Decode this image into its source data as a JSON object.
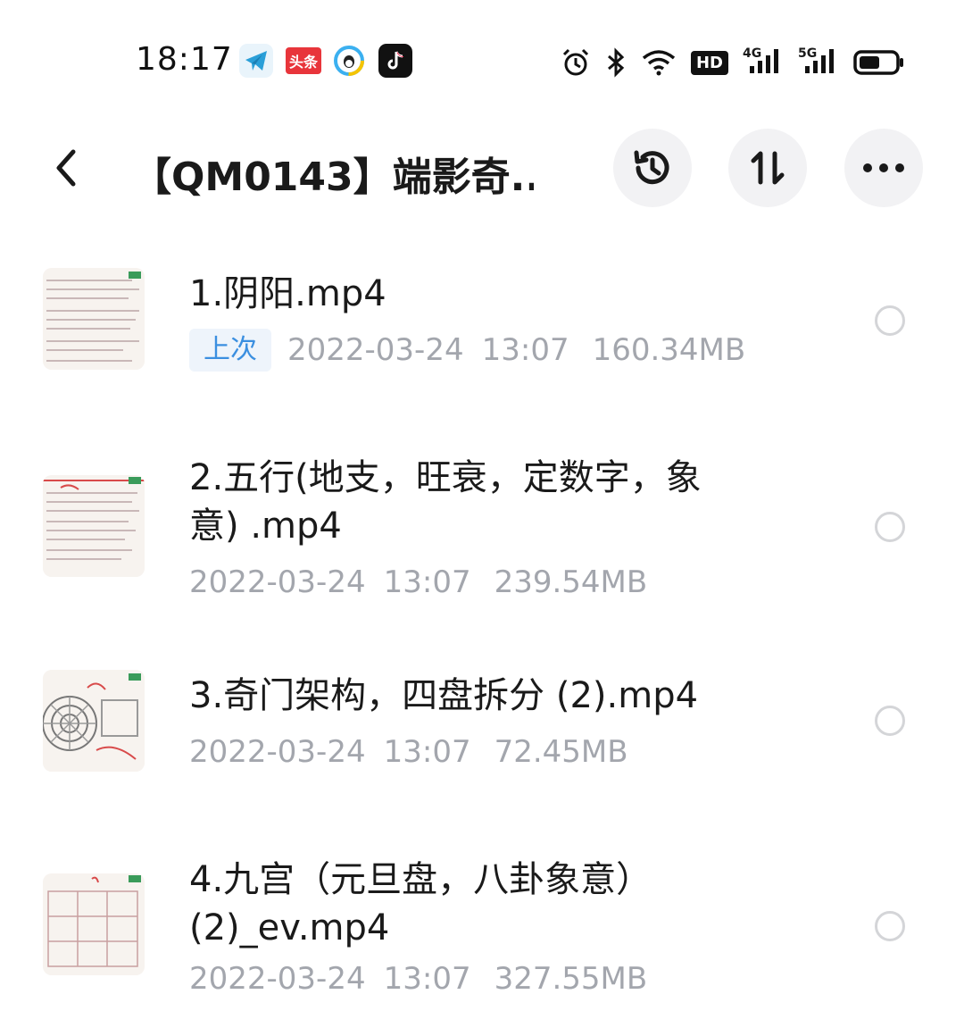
{
  "status_bar": {
    "time": "18:17",
    "apps": [
      {
        "name": "telegram-icon",
        "label": ""
      },
      {
        "name": "toutiao-icon",
        "label": "头条"
      },
      {
        "name": "qq-icon",
        "label": ""
      },
      {
        "name": "tiktok-icon",
        "label": ""
      }
    ],
    "system": [
      "alarm-icon",
      "bluetooth-icon",
      "wifi-icon",
      "hd-icon",
      "signal-4g-icon",
      "signal-5g-icon",
      "battery-icon"
    ],
    "hd_label": "HD",
    "net1_label": "4G",
    "net2_label": "5G"
  },
  "header": {
    "title": "【QM0143】端影奇...",
    "buttons": [
      "history-icon",
      "sort-icon",
      "more-icon"
    ]
  },
  "files": [
    {
      "name": "1.阴阳.mp4",
      "badge": "上次",
      "date": "2022-03-24",
      "time": "13:07",
      "size": "160.34MB"
    },
    {
      "name": "2.五行(地支，旺衰，定数字，象意) .mp4",
      "badge": "",
      "date": "2022-03-24",
      "time": "13:07",
      "size": "239.54MB"
    },
    {
      "name": "3.奇门架构，四盘拆分 (2).mp4",
      "badge": "",
      "date": "2022-03-24",
      "time": "13:07",
      "size": "72.45MB"
    },
    {
      "name": "4.九宫（元旦盘，八卦象意）(2)_ev.mp4",
      "badge": "",
      "date": "2022-03-24",
      "time": "13:07",
      "size": "327.55MB"
    }
  ],
  "colors": {
    "badge_text": "#3b8fe0",
    "badge_bg": "#eef4fb",
    "meta_text": "#a3a6ad",
    "button_bg": "#f2f2f4"
  }
}
